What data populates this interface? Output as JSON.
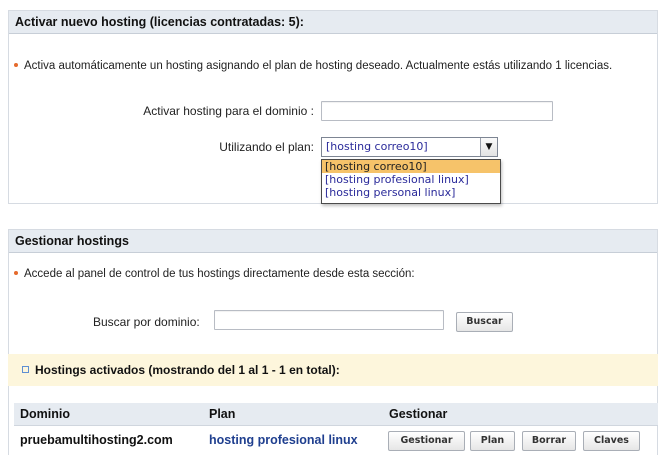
{
  "activate_section": {
    "title": "Activar nuevo hosting (licencias contratadas: 5):",
    "info": "Activa automáticamente un hosting asignando el plan de hosting deseado. Actualmente estás utilizando 1 licencias.",
    "domain_label": "Activar hosting para el dominio :",
    "domain_value": "",
    "plan_label": "Utilizando el plan:",
    "plan_selected": "[hosting correo10]",
    "plan_options": [
      "[hosting correo10]",
      "[hosting profesional linux]",
      "[hosting personal linux]"
    ]
  },
  "manage_section": {
    "title": "Gestionar hostings",
    "info": "Accede al panel de control de tus hostings directamente desde esta sección:",
    "search_label": "Buscar por dominio:",
    "search_value": "",
    "search_button": "Buscar",
    "active_header": "Hostings activados (mostrando del 1 al 1 - 1 en total):",
    "columns": [
      "Dominio",
      "Plan",
      "Gestionar"
    ],
    "rows": [
      {
        "domain": "pruebamultihosting2.com",
        "plan": "hosting profesional linux",
        "actions": [
          "Gestionar",
          "Plan",
          "Borrar",
          "Claves"
        ]
      }
    ]
  },
  "colors": {
    "header_bg": "#e6ebf1",
    "bullet": "#e56a2c",
    "link_blue": "#1f3f8f",
    "highlight": "#f6c36a",
    "subheader_bg": "#fdf6dc"
  }
}
